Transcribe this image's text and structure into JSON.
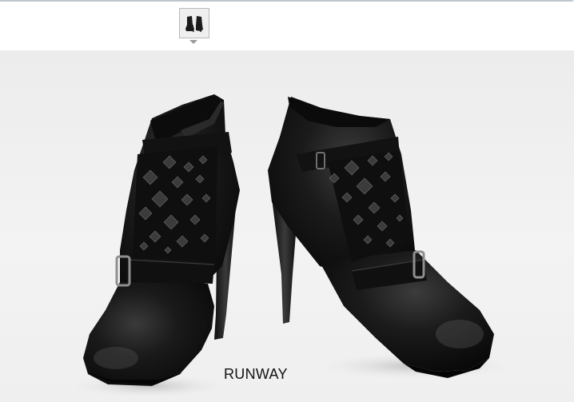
{
  "gallery": {
    "thumbnail_icon": "boots-thumbnail-icon",
    "caption": "RUNWAY"
  },
  "colors": {
    "rule": "#bcc6cc",
    "thumb_border": "#b9b9b9",
    "leather": "#161616",
    "stud": "#3a3a3a"
  }
}
